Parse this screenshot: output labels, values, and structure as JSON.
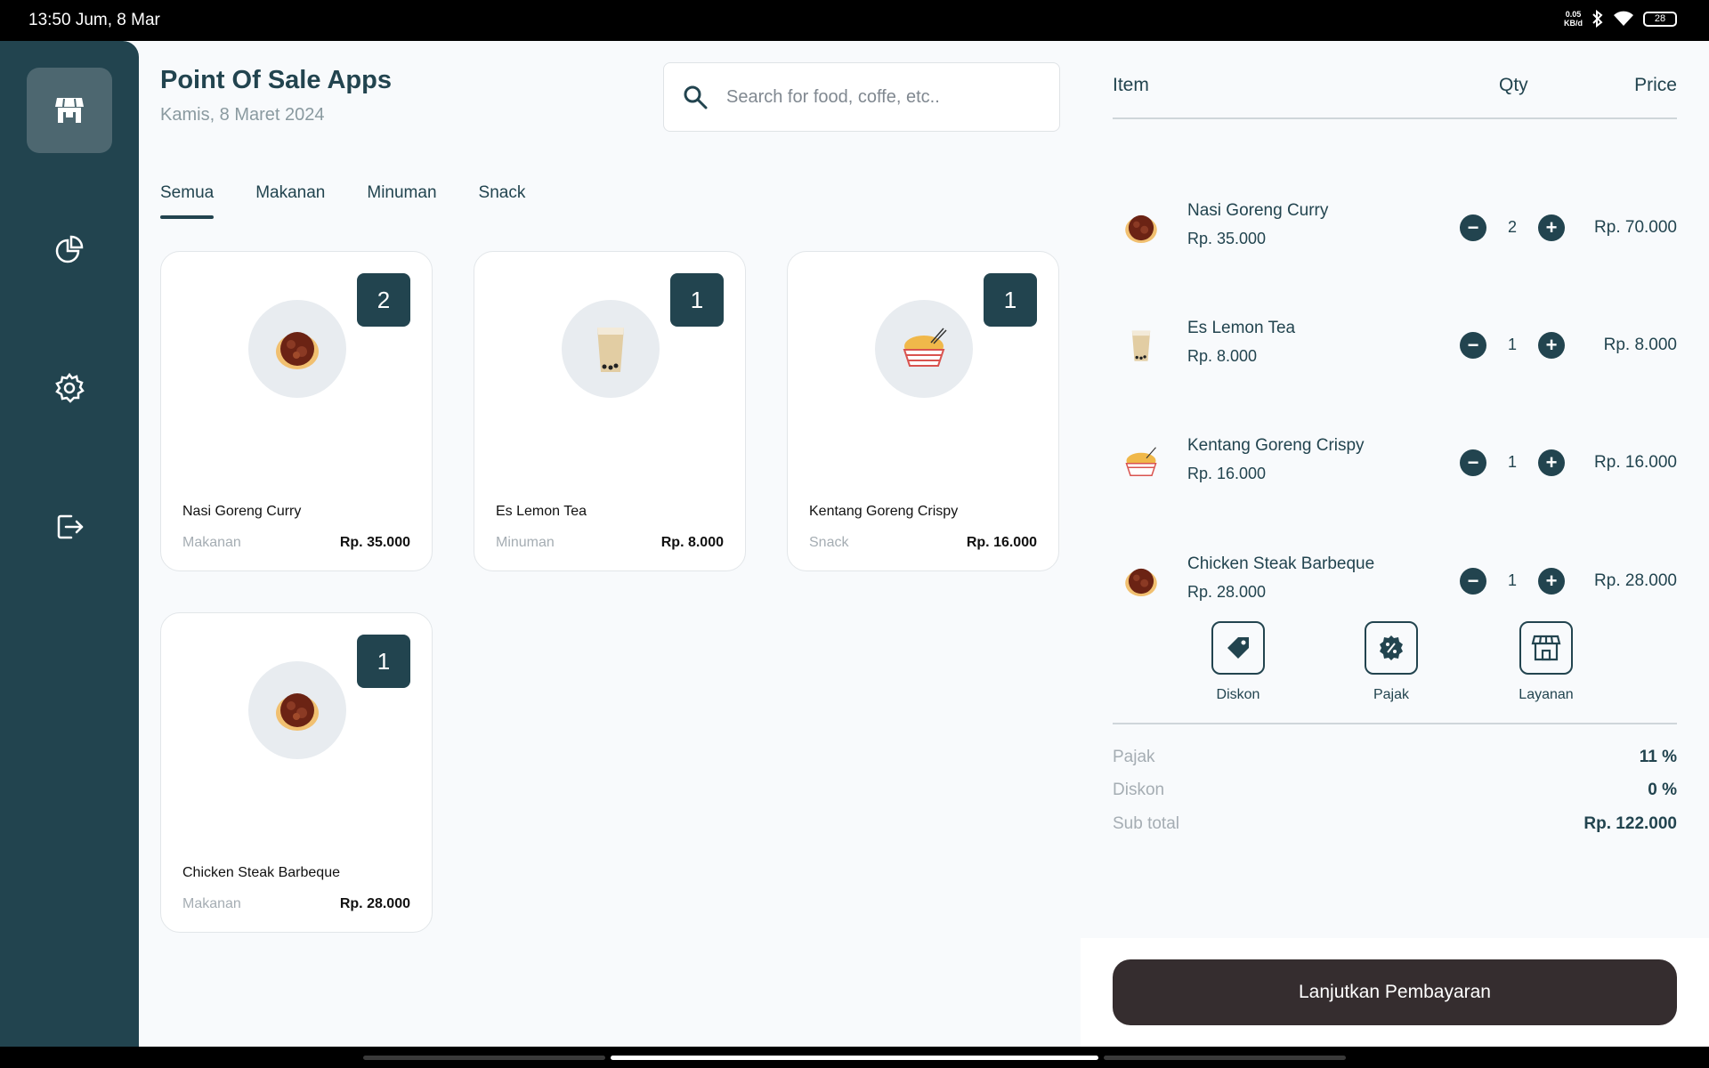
{
  "status": {
    "time": "13:50 Jum, 8 Mar",
    "net_top": "0.05",
    "net_bottom": "KB/d",
    "battery": "28"
  },
  "sidebar": {
    "items": [
      {
        "name": "store",
        "icon": "store-icon",
        "active": true
      },
      {
        "name": "reports",
        "icon": "pie-chart-icon"
      },
      {
        "name": "settings",
        "icon": "gear-icon"
      },
      {
        "name": "logout",
        "icon": "logout-icon"
      }
    ]
  },
  "header": {
    "title": "Point Of Sale Apps",
    "date": "Kamis, 8 Maret 2024"
  },
  "search": {
    "placeholder": "Search for food, coffe, etc.."
  },
  "tabs": [
    "Semua",
    "Makanan",
    "Minuman",
    "Snack"
  ],
  "products": [
    {
      "name": "Nasi Goreng Curry",
      "category": "Makanan",
      "price": "Rp. 35.000",
      "qty": "2",
      "image": "curry-bowl-icon"
    },
    {
      "name": "Es Lemon Tea",
      "category": "Minuman",
      "price": "Rp. 8.000",
      "qty": "1",
      "image": "milk-tea-icon"
    },
    {
      "name": "Kentang Goreng Crispy",
      "category": "Snack",
      "price": "Rp. 16.000",
      "qty": "1",
      "image": "fries-icon"
    },
    {
      "name": "Chicken Steak Barbeque",
      "category": "Makanan",
      "price": "Rp. 28.000",
      "qty": "1",
      "image": "curry-bowl-icon"
    }
  ],
  "order": {
    "headers": {
      "item": "Item",
      "qty": "Qty",
      "price": "Price"
    },
    "items": [
      {
        "name": "Nasi Goreng Curry",
        "unit_price": "Rp. 35.000",
        "qty": "2",
        "total": "Rp. 70.000"
      },
      {
        "name": "Es Lemon Tea",
        "unit_price": "Rp. 8.000",
        "qty": "1",
        "total": "Rp. 8.000"
      },
      {
        "name": "Kentang Goreng Crispy",
        "unit_price": "Rp. 16.000",
        "qty": "1",
        "total": "Rp. 16.000"
      },
      {
        "name": "Chicken Steak Barbeque",
        "unit_price": "Rp. 28.000",
        "qty": "1",
        "total": "Rp. 28.000"
      }
    ],
    "actions": {
      "discount": "Diskon",
      "tax": "Pajak",
      "service": "Layanan"
    },
    "summary": {
      "tax_label": "Pajak",
      "tax_value": "11 %",
      "discount_label": "Diskon",
      "discount_value": "0 %",
      "subtotal_label": "Sub total",
      "subtotal_value": "Rp. 122.000"
    },
    "pay_label": "Lanjutkan Pembayaran"
  },
  "colors": {
    "primary": "#22444f",
    "pay_button": "#352d2f",
    "background": "#f8fafc"
  }
}
